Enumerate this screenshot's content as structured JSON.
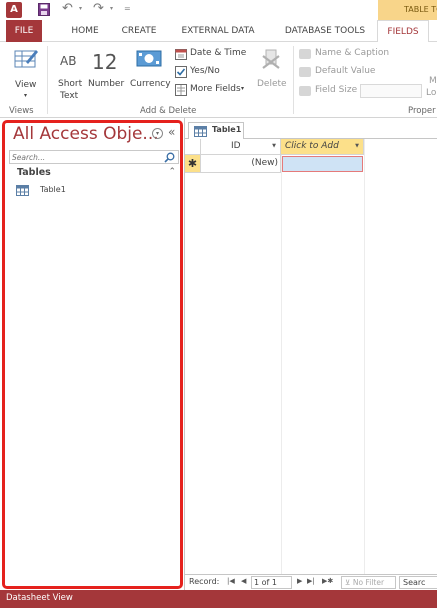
{
  "quick_access": {
    "logo": "A",
    "customize": "="
  },
  "context_tab": {
    "label": "TABLE TO"
  },
  "tabs": {
    "file": "FILE",
    "home": "HOME",
    "create": "CREATE",
    "external_data": "EXTERNAL DATA",
    "database_tools": "DATABASE TOOLS",
    "fields": "FIELDS"
  },
  "ribbon": {
    "views": {
      "view_label": "View",
      "group_label": "Views"
    },
    "add_delete": {
      "short_text_icon": "AB",
      "short_text_line1": "Short",
      "short_text_line2": "Text",
      "number_icon": "12",
      "number_label": "Number",
      "currency_label": "Currency",
      "date_time": "Date & Time",
      "yes_no": "Yes/No",
      "more_fields": "More Fields",
      "delete": "Delete",
      "group_label": "Add & Delete"
    },
    "properties": {
      "name_caption": "Name & Caption",
      "default_value": "Default Value",
      "field_size": "Field Size",
      "group_label": "Proper",
      "lookup_label_1": "M",
      "lookup_label_2": "Lo"
    }
  },
  "nav_pane": {
    "title": "All Access Obje...",
    "search_placeholder": "Search...",
    "group_label": "Tables",
    "items": [
      {
        "label": "Table1"
      }
    ]
  },
  "document": {
    "tab_label": "Table1",
    "columns": [
      {
        "label": "ID"
      },
      {
        "label": "Click to Add"
      }
    ],
    "new_row": {
      "selector": "✱",
      "id_value": "(New)"
    }
  },
  "record_nav": {
    "label": "Record:",
    "position": "1 of 1",
    "filter": "No Filter",
    "search": "Searc"
  },
  "status_bar": {
    "text": "Datasheet View"
  },
  "colors": {
    "access_accent": "#a4373a",
    "highlight": "#fce08a",
    "selection_outline": "#e5211d"
  },
  "icons": [
    "access-logo-icon",
    "save-icon",
    "undo-icon",
    "redo-icon",
    "view-icon",
    "short-text-icon",
    "number-icon",
    "currency-icon",
    "date-time-icon",
    "checkbox-icon",
    "more-fields-icon",
    "delete-icon",
    "name-caption-icon",
    "default-value-icon",
    "field-size-icon",
    "search-icon",
    "table-icon",
    "chevron-up-icon",
    "collapse-icon",
    "menu-circle-icon"
  ]
}
